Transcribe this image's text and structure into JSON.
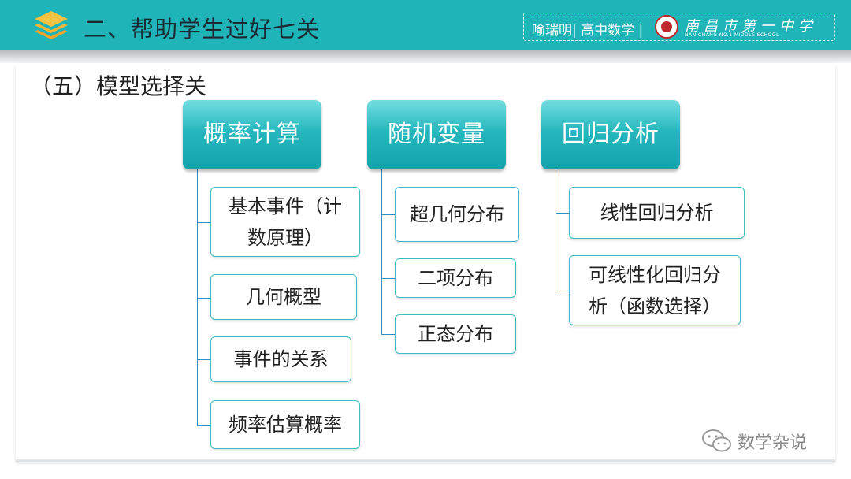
{
  "header": {
    "title": "二、帮助学生过好七关",
    "icon": "layers-icon",
    "brand_text": "喻瑞明| 高中数学 |",
    "school_name": "南昌市第一中学",
    "school_sub": "NAN CHANG NO.1 MIDDLE SCHOOL"
  },
  "section": {
    "title": "（五）模型选择关"
  },
  "categories": [
    {
      "label": "概率计算",
      "items": [
        "基本事件（计数原理）",
        "几何概型",
        "事件的关系",
        "频率估算概率"
      ]
    },
    {
      "label": "随机变量",
      "items": [
        "超几何分布",
        "二项分布",
        "正态分布"
      ]
    },
    {
      "label": "回归分析",
      "items": [
        "线性回归分析",
        "可线性化回归分析（函数选择）"
      ]
    }
  ],
  "display": {
    "item_1_line1": "基本事件（计",
    "item_1_line2": "数原理）",
    "item_9_line1": "可线性化回归分",
    "item_9_line2": "析（函数选择）"
  },
  "footer": {
    "text": "数学杂说",
    "icon": "wechat-icon"
  },
  "colors": {
    "header": "#1fb4b8",
    "accent": "#3cbcc0",
    "connector": "#2f8fc4"
  }
}
